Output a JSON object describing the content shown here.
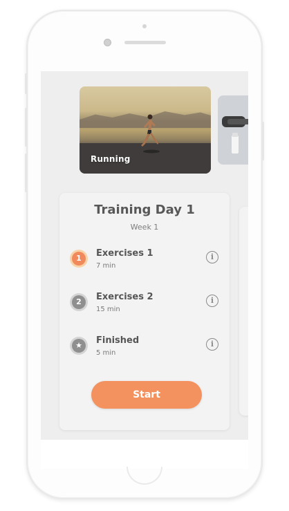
{
  "carousel": {
    "cards": [
      {
        "label": "Running"
      },
      {
        "label": ""
      }
    ]
  },
  "training": {
    "title": "Training Day 1",
    "week": "Week 1",
    "items": [
      {
        "number": "1",
        "title": "Exercises 1",
        "duration": "7 min",
        "state": "active",
        "info_icon": "info-icon"
      },
      {
        "number": "2",
        "title": "Exercises 2",
        "duration": "15 min",
        "state": "pending",
        "info_icon": "info-icon"
      },
      {
        "number": "★",
        "title": "Finished",
        "duration": "5 min",
        "state": "pending",
        "info_icon": "info-icon"
      }
    ],
    "start_label": "Start"
  },
  "colors": {
    "accent": "#f3915f",
    "badge_active": "#f08a5d",
    "badge_pending": "#8f8f8f",
    "screen_bg": "#eeeeee",
    "card_bg": "#f3f3f3"
  }
}
